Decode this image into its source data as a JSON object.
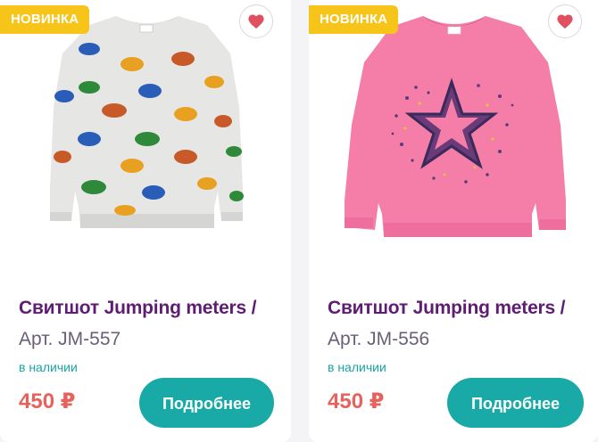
{
  "products": [
    {
      "badge": "НОВИНКА",
      "title": "Свитшот Jumping meters /",
      "article": "Арт. JM-557",
      "stock": "в наличии",
      "price": "450 ₽",
      "button": "Подробнее"
    },
    {
      "badge": "НОВИНКА",
      "title": "Свитшот Jumping meters /",
      "article": "Арт. JM-556",
      "stock": "в наличии",
      "price": "450 ₽",
      "button": "Подробнее"
    }
  ],
  "colors": {
    "badge": "#f7c51a",
    "title": "#5e1d73",
    "price": "#e5635c",
    "stock": "#1aa3a3",
    "button": "#19a9a6",
    "heart": "#e0505e"
  },
  "icons": {
    "favorite": "heart-icon"
  }
}
